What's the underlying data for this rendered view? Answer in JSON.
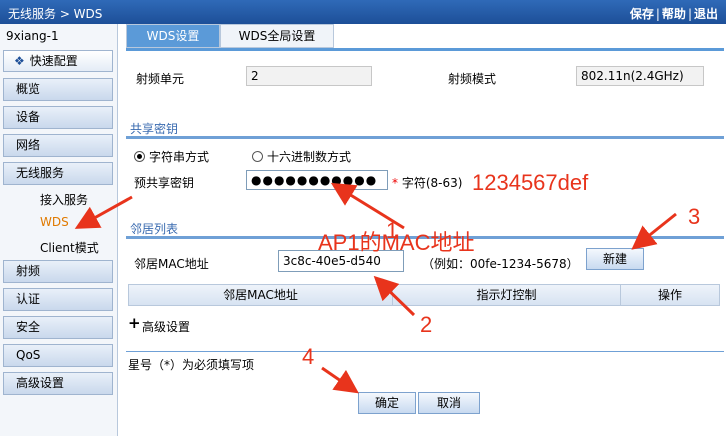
{
  "header": {
    "title": "无线服务 > WDS",
    "links": [
      "保存",
      "帮助",
      "退出"
    ]
  },
  "nav": {
    "device_name": "9xiang-1",
    "quick_config": "快速配置",
    "items": [
      "概览",
      "设备",
      "网络",
      "无线服务"
    ],
    "sub_items": [
      "接入服务",
      "WDS",
      "Client模式"
    ],
    "items_after": [
      "射频",
      "认证",
      "安全",
      "QoS",
      "高级设置"
    ]
  },
  "tabs": [
    "WDS设置",
    "WDS全局设置"
  ],
  "radio": {
    "unit_label": "射频单元",
    "unit_value": "2",
    "mode_label": "射频模式",
    "mode_value": "802.11n(2.4GHz)"
  },
  "shared_key": {
    "section_title": "共享密钥",
    "option_string": "字符串方式",
    "option_hex": "十六进制数方式",
    "psk_label": "预共享密钥",
    "psk_value": "●●●●●●●●●●●",
    "hint_star": "*",
    "hint_text": "字符(8-63)"
  },
  "neighbor": {
    "section_title": "邻居列表",
    "mac_label": "邻居MAC地址",
    "mac_value": "3c8c-40e5-d540",
    "example": "（例如：00fe-1234-5678）",
    "new_button": "新建",
    "columns": [
      "邻居MAC地址",
      "指示灯控制",
      "操作"
    ]
  },
  "advanced": {
    "plus": "+",
    "label": "高级设置"
  },
  "footer": {
    "note": "星号（*）为必须填写项",
    "ok_button": "确定",
    "cancel_button": "取消"
  },
  "annotations": {
    "password": "1234567def",
    "mac_note": "AP1的MAC地址",
    "n1": "1",
    "n2": "2",
    "n3": "3",
    "n4": "4",
    "color": "#e8341c"
  }
}
